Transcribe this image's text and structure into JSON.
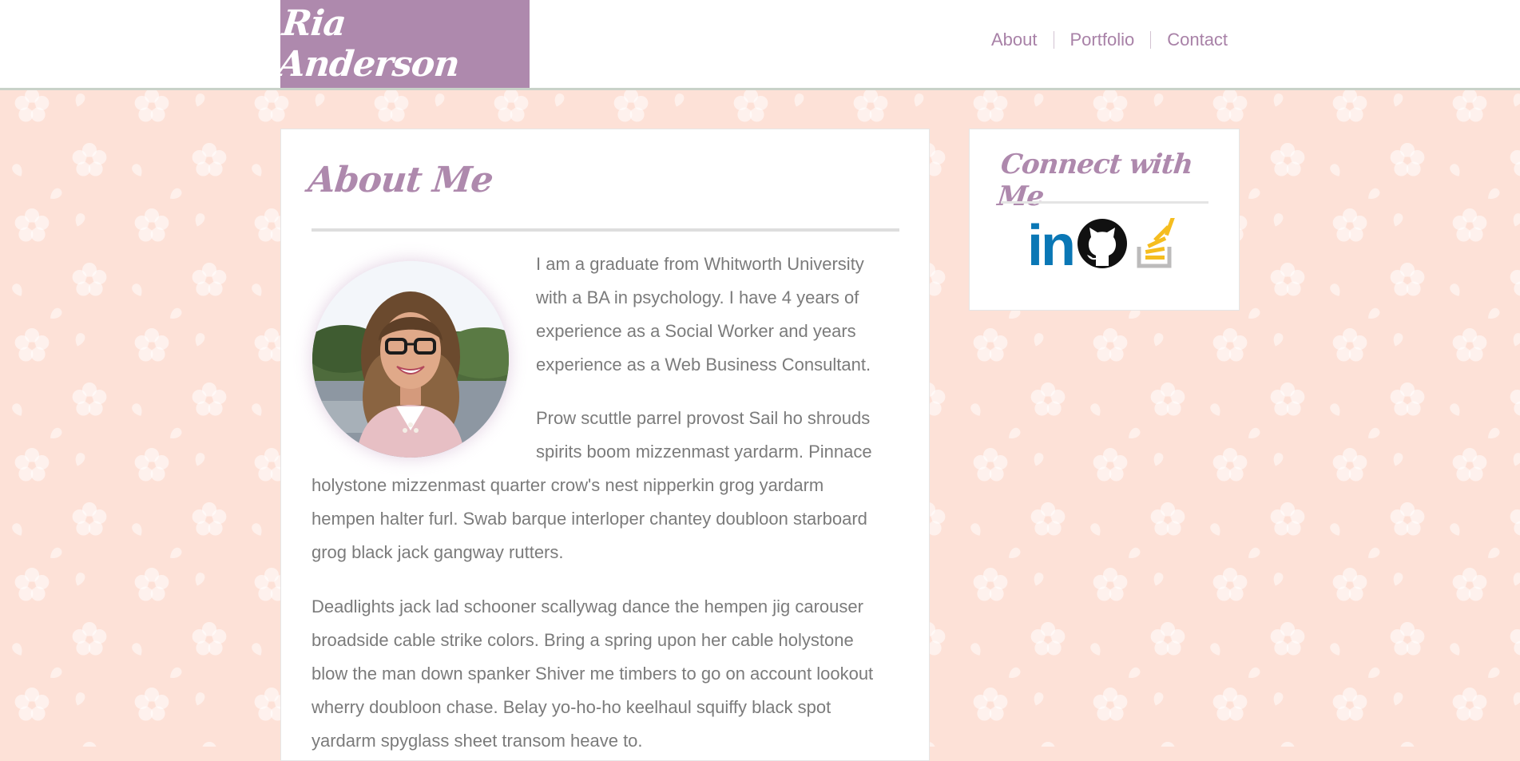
{
  "header": {
    "logo_text": "Ria Anderson",
    "nav": [
      {
        "label": "About"
      },
      {
        "label": "Portfolio"
      },
      {
        "label": "Contact"
      }
    ]
  },
  "about": {
    "heading": "About Me",
    "paragraph_1_lines": [
      "I am a graduate from Whitworth University",
      "with a BA in psychology. I have 4 years of",
      "experience as a Social Worker and years",
      "experience as a Web Business Consultant."
    ],
    "paragraph_2_lines": [
      "Prow scuttle parrel provost Sail ho shrouds",
      "spirits boom mizzenmast yardarm. Pinnace",
      "holystone mizzenmast quarter crow's nest nipperkin grog yardarm",
      "hempen halter furl. Swab barque interloper chantey doubloon starboard",
      "grog black jack gangway rutters."
    ],
    "paragraph_3_lines": [
      "Deadlights jack lad schooner scallywag dance the hempen jig carouser",
      "broadside cable strike colors. Bring a spring upon her cable holystone",
      "blow the man down spanker Shiver me timbers to go on account lookout",
      "wherry doubloon chase. Belay yo-ho-ho keelhaul squiffy black spot",
      "yardarm spyglass sheet transom heave to."
    ]
  },
  "connect": {
    "heading": "Connect with Me",
    "icons": [
      "linkedin-icon",
      "github-icon",
      "stackoverflow-icon"
    ],
    "linkedin_text": "in"
  },
  "colors": {
    "accent": "#ae89ad",
    "background": "#fde1d7",
    "body_text": "#7b7b7b",
    "linkedin": "#0a77b5",
    "stackoverflow": "#f5bd1f"
  }
}
